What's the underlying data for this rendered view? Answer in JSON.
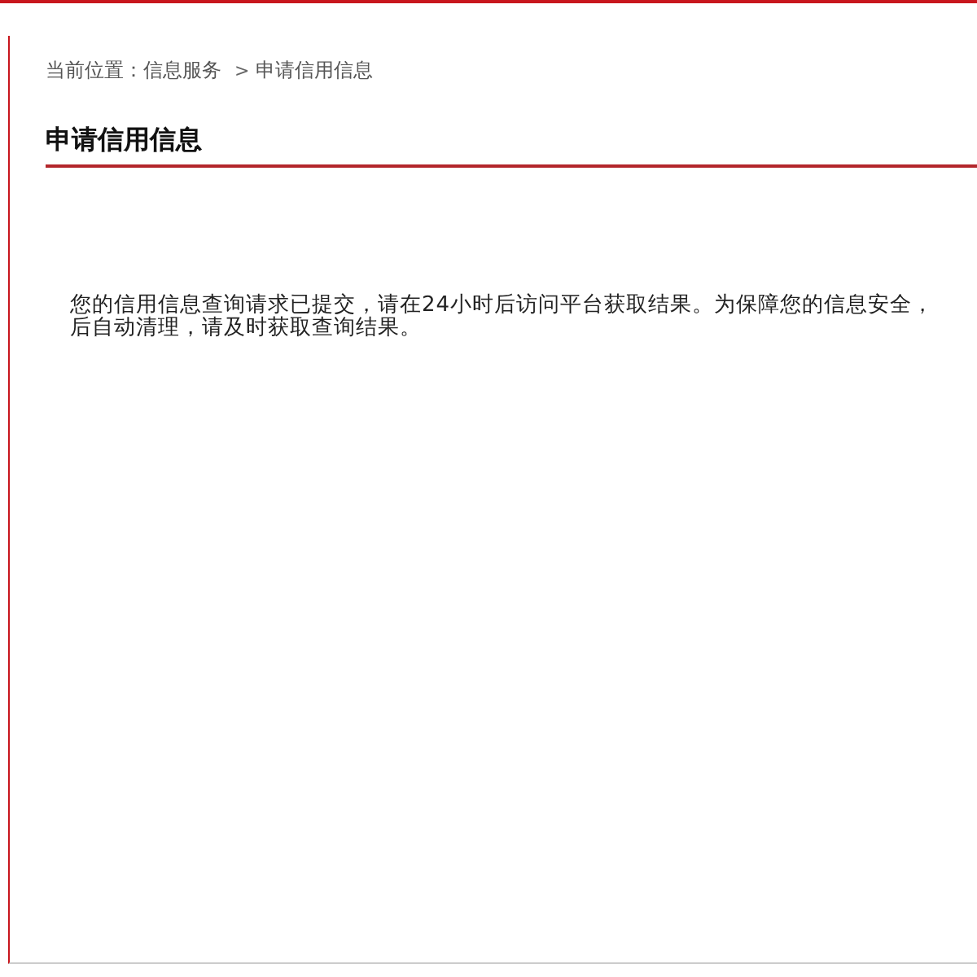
{
  "breadcrumb": {
    "label": "当前位置：",
    "items": [
      "信息服务",
      "申请信用信息"
    ],
    "separator": ">"
  },
  "title": "申请信用信息",
  "message_lines": [
    "您的信用信息查询请求已提交，请在24小时后访问平台获取结果。为保障您的信息安全，",
    "后自动清理，请及时获取查询结果。"
  ]
}
